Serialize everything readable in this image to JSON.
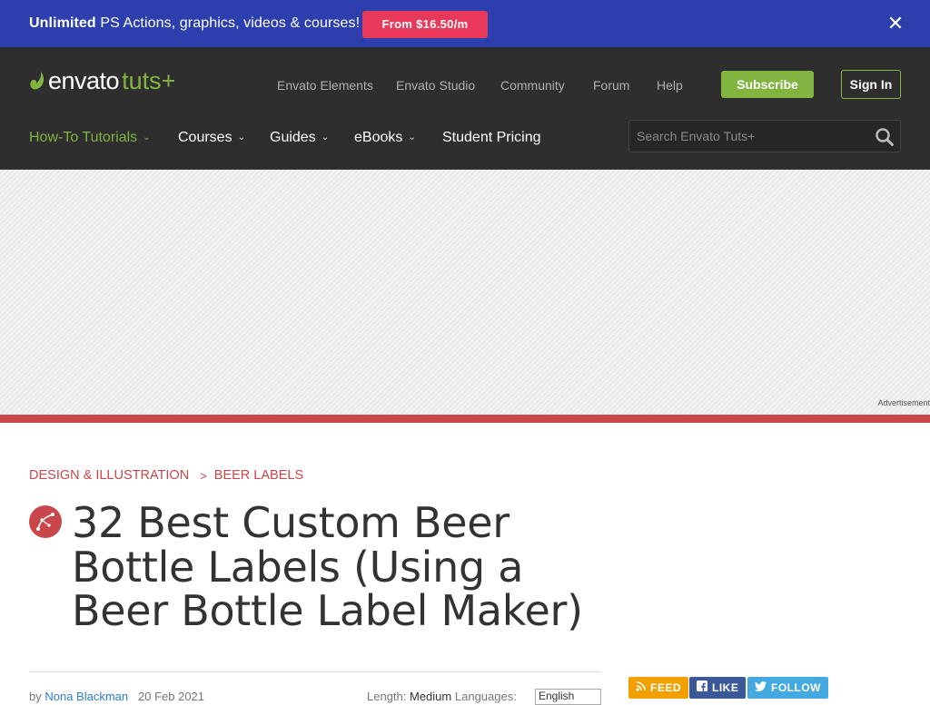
{
  "promo": {
    "bold": "Unlimited",
    "text": " PS Actions, graphics, videos & courses!",
    "button": "From $16.50/m",
    "close": "✕"
  },
  "header": {
    "logo_envato": "envato",
    "logo_tuts": "tuts+",
    "top_nav": [
      "Envato Elements",
      "Envato Studio",
      "Community",
      "Forum",
      "Help"
    ],
    "subscribe": "Subscribe",
    "signin": "Sign In",
    "main_nav": [
      {
        "label": "How-To Tutorials",
        "active": true,
        "dropdown": true
      },
      {
        "label": "Courses",
        "active": false,
        "dropdown": true
      },
      {
        "label": "Guides",
        "active": false,
        "dropdown": true
      },
      {
        "label": "eBooks",
        "active": false,
        "dropdown": true
      },
      {
        "label": "Student Pricing",
        "active": false,
        "dropdown": false
      }
    ],
    "search_placeholder": "Search Envato Tuts+"
  },
  "ad": {
    "label": "Advertisement"
  },
  "article": {
    "breadcrumb": [
      "Design & Illustration",
      "Beer Labels"
    ],
    "title": "32 Best Custom Beer Bottle Labels (Using a Beer Bottle Label Maker)",
    "meta": {
      "by": "by",
      "author": "Nona Blackman",
      "date": "20 Feb 2021",
      "length_label": "Length:",
      "length_value": "Medium",
      "languages_label": "Languages:",
      "language_selected": "English"
    }
  },
  "social": {
    "feed": "FEED",
    "like": "LIKE",
    "follow": "FOLLOW"
  },
  "colors": {
    "promo_bg": "#2c3fad",
    "promo_button": "#e8395b",
    "header_bg": "#2e2e2e",
    "accent_green": "#82b540",
    "accent_red": "#c9474b",
    "feed": "#f2a000",
    "like": "#3b5998",
    "follow": "#44a9e0"
  }
}
